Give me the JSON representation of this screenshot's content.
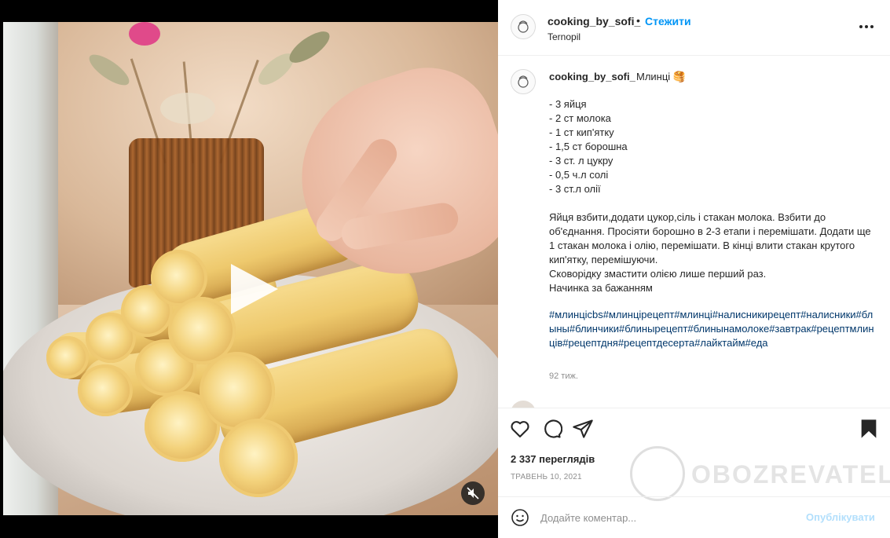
{
  "post": {
    "username": "cooking_by_sofi_",
    "follow_label": "Стежити",
    "separator": "•",
    "location": "Ternopil"
  },
  "caption": {
    "username": "cooking_by_sofi_",
    "title": "Млинці 🥞",
    "ingredients": [
      "- 3 яйця",
      "- 2 ст молока",
      "- 1 ст кип'ятку",
      "- 1,5 ст борошна",
      "- 3 ст. л цукру",
      "- 0,5 ч.л солі",
      "- 3 ст.л олії"
    ],
    "instructions": [
      "Яйця взбити,додати цукор,сіль і стакан молока. Взбити до об'єднання.   Просіяти борошно в 2-3 етапи і перемішати. Додати ще 1 стакан молока і олію, перемішати. В кінці влити стакан крутого кип'ятку, перемішуючи.",
      "Сковорідку змастити олією лише перший раз.",
      "Начинка за бажанням"
    ],
    "hashtags": "#млинціcbs#млинцірецепт#млинці#налисникирецепт#налисники#блыны#блинчики#блинырецепт#блинынамолоке#завтрак#рецептмлинців#рецептдня#рецептдесерта#лайктайм#еда",
    "age": "92 тиж."
  },
  "next_comment_peek": "________ ____",
  "actions": {
    "icons": [
      "heart-icon",
      "comment-icon",
      "share-icon",
      "bookmark-icon"
    ]
  },
  "views": "2 337 переглядів",
  "date": "ТРАВЕНЬ 10, 2021",
  "comment_box": {
    "placeholder": "Додайте коментар...",
    "publish_label": "Опублікувати"
  },
  "watermark": {
    "text": "OBOZREVATEL"
  },
  "colors": {
    "link_blue": "#0095f6",
    "publish_disabled": "#b2dffc",
    "hashtag": "#00376b",
    "text": "#262626",
    "muted": "#8e8e8e"
  }
}
